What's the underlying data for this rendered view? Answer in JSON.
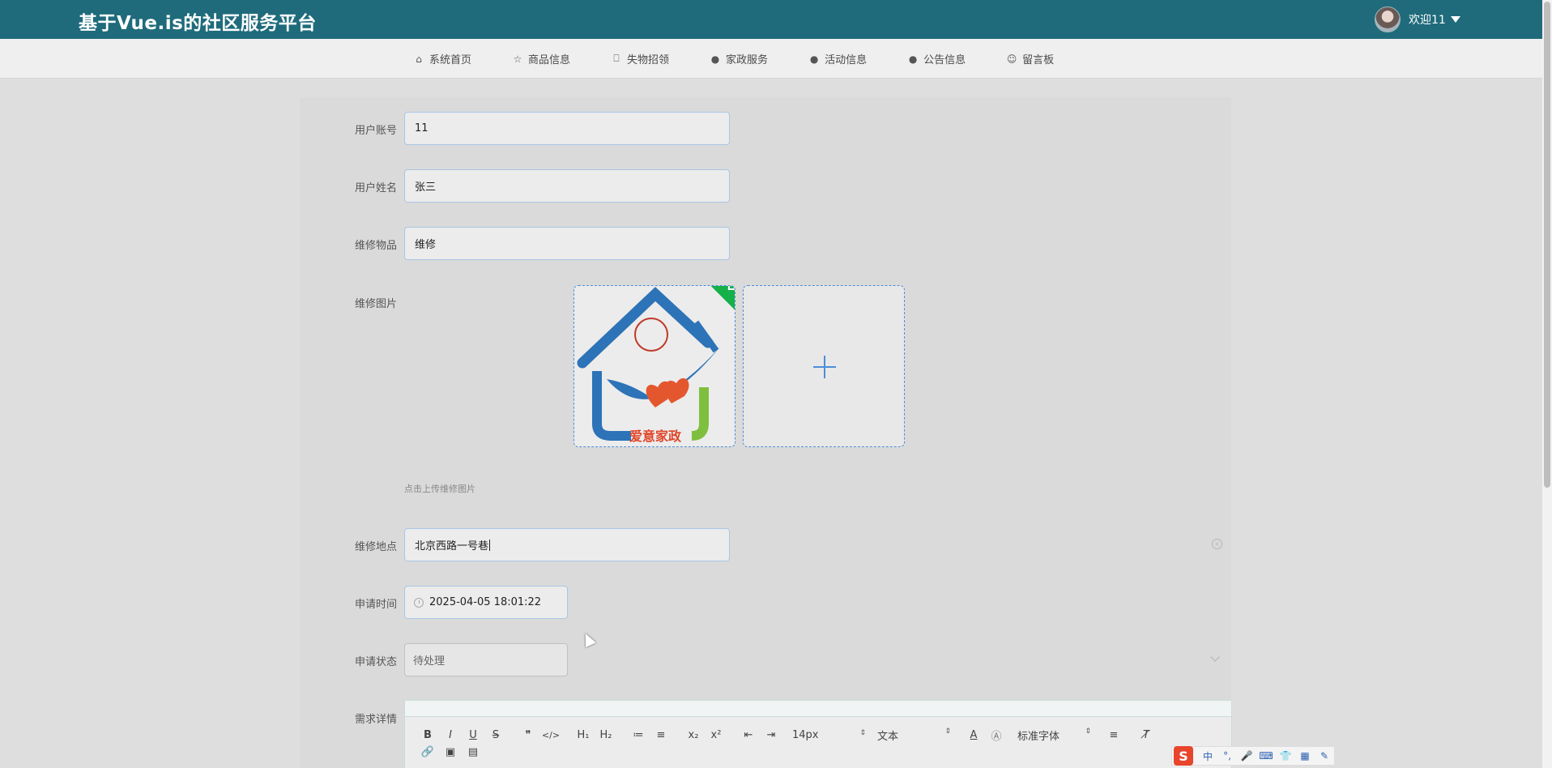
{
  "header": {
    "title": "基于Vue.is的社区服务平台",
    "welcome": "欢迎11"
  },
  "nav": {
    "items": [
      {
        "label": "系统首页",
        "icon": "home-icon",
        "glyph": "⌂"
      },
      {
        "label": "商品信息",
        "icon": "star-icon",
        "glyph": "☆"
      },
      {
        "label": "失物招领",
        "icon": "bag-icon",
        "glyph": "⎕"
      },
      {
        "label": "家政服务",
        "icon": "alert-icon",
        "glyph": "●"
      },
      {
        "label": "活动信息",
        "icon": "question-icon",
        "glyph": "●"
      },
      {
        "label": "公告信息",
        "icon": "info-icon",
        "glyph": "●"
      },
      {
        "label": "留言板",
        "icon": "smile-icon",
        "glyph": "☺"
      }
    ]
  },
  "form": {
    "account": {
      "label": "用户账号",
      "value": "11"
    },
    "name": {
      "label": "用户姓名",
      "value": "张三"
    },
    "item": {
      "label": "维修物品",
      "value": "维修"
    },
    "image": {
      "label": "维修图片",
      "hint": "点击上传维修图片",
      "logo_text": "爱意家政"
    },
    "location": {
      "label": "维修地点",
      "value": "北京西路一号巷"
    },
    "apply_time": {
      "label": "申请时间",
      "value": "2025-04-05 18:01:22"
    },
    "status": {
      "label": "申请状态",
      "value": "待处理"
    },
    "details": {
      "label": "需求详情"
    }
  },
  "editor": {
    "toolbar": [
      "B",
      "I",
      "U",
      "S",
      "❞",
      "</>",
      "H₁",
      "H₂",
      "≔",
      "≡",
      "x₂",
      "x²",
      "⇤",
      "⇥"
    ],
    "font_size": "14px",
    "format": "文本",
    "font": "标准字体",
    "row2": [
      "🔗",
      "▣",
      "▤"
    ]
  },
  "ime": {
    "logo": "S",
    "mode": "中",
    "items": [
      "°,",
      "🎤",
      "⌨",
      "👕",
      "▦",
      "✎"
    ]
  },
  "colors": {
    "header": "#1f6b7b",
    "accent": "#4d8ed8",
    "success": "#16b04a"
  }
}
